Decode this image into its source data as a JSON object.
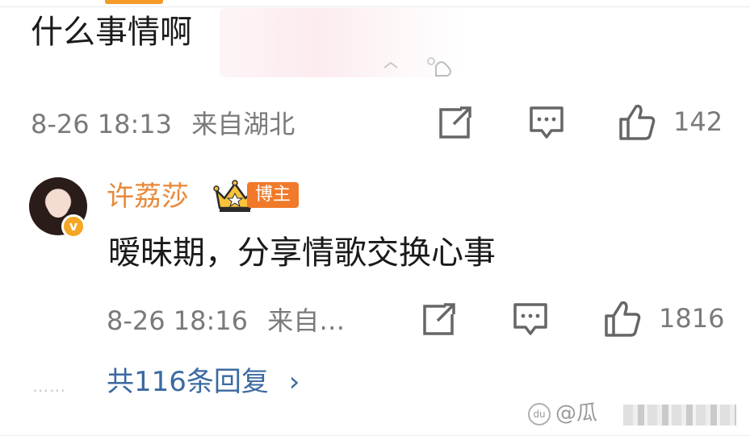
{
  "comment": {
    "text": "什么事情啊",
    "time": "8-26 18:13",
    "location": "来自湖北",
    "like_count": "142"
  },
  "reply": {
    "username": "许荔莎",
    "badge_label": "博主",
    "verified_mark": "v",
    "text": "暧昧期，分享情歌交换心事",
    "time": "8-26 18:16",
    "location": "来自…",
    "like_count": "1816"
  },
  "replies_summary": {
    "dots": "⋯⋯",
    "label": "共116条回复",
    "chevron": "›"
  },
  "watermark": {
    "logo": "du",
    "text": "@瓜"
  },
  "icons": {
    "share": "share-icon",
    "comment": "comment-icon",
    "like": "thumbs-up-icon",
    "crown": "crown-icon"
  },
  "colors": {
    "username": "#e8893a",
    "badge": "#f07a2a",
    "link": "#3b6aa0",
    "meta": "#7a7a7a"
  }
}
